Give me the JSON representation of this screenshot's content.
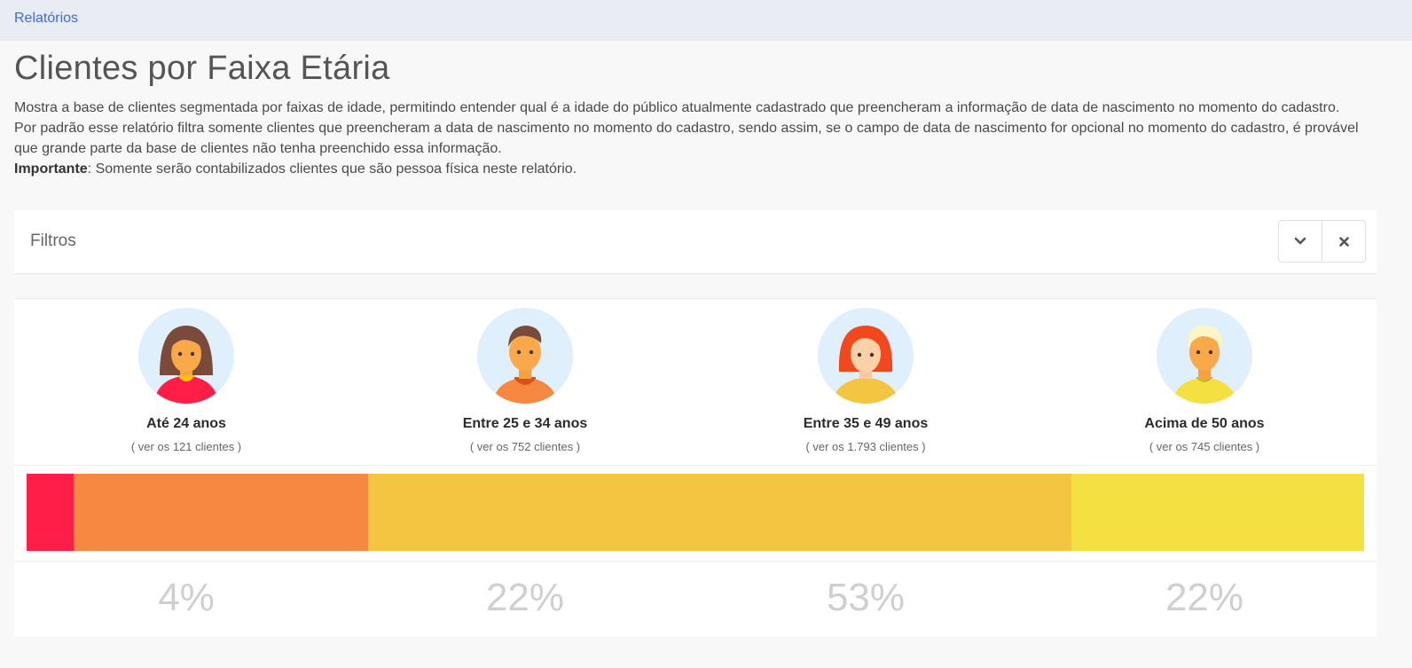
{
  "breadcrumb": {
    "label": "Relatórios"
  },
  "page": {
    "title": "Clientes por Faixa Etária",
    "desc_line1": "Mostra a base de clientes segmentada por faixas de idade, permitindo entender qual é a idade do público atualmente cadastrado que preencheram a informação de data de nascimento no momento do cadastro.",
    "desc_line2": "Por padrão esse relatório filtra somente clientes que preencheram a data de nascimento no momento do cadastro, sendo assim, se o campo de data de nascimento for opcional no momento do cadastro, é provável que grande parte da base de clientes não tenha preenchido essa informação.",
    "important_label": "Importante",
    "important_text": ": Somente serão contabilizados clientes que são pessoa física neste relatório."
  },
  "filters": {
    "title": "Filtros",
    "expand_icon": "chevron-down-icon",
    "close_icon": "close-icon"
  },
  "age_groups": [
    {
      "label": "Até 24 anos",
      "link": "( ver os 121 clientes )",
      "percent": "4%",
      "share": 3.5,
      "color": "#fe1e47",
      "avatar": "young-woman-icon"
    },
    {
      "label": "Entre 25 e 34 anos",
      "link": "( ver os 752 clientes )",
      "percent": "22%",
      "share": 22.0,
      "color": "#f78842",
      "avatar": "young-man-icon"
    },
    {
      "label": "Entre 35 e 49 anos",
      "link": "( ver os 1.793 clientes )",
      "percent": "53%",
      "share": 52.6,
      "color": "#f4c541",
      "avatar": "red-haired-woman-icon"
    },
    {
      "label": "Acima de 50 anos",
      "link": "( ver os 745 clientes )",
      "percent": "22%",
      "share": 21.9,
      "color": "#f4e040",
      "avatar": "older-man-icon"
    }
  ]
}
